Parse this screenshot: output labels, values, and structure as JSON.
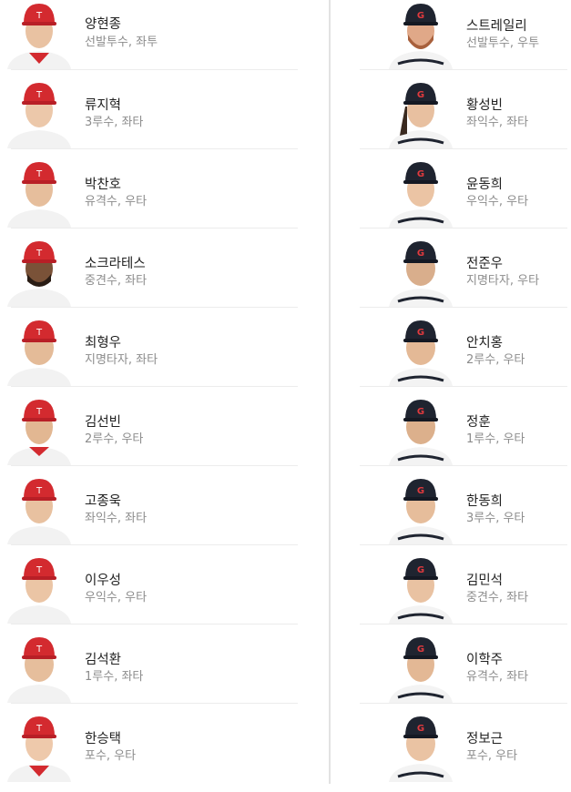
{
  "colors": {
    "home_cap": "#d32a2f",
    "away_cap": "#1f2430",
    "home_jersey": "#f2f2f2",
    "away_jersey": "#f3f3f3"
  },
  "home_players": [
    {
      "name": "양현종",
      "info": "선발투수, 좌투"
    },
    {
      "name": "류지혁",
      "info": "3루수, 좌타"
    },
    {
      "name": "박찬호",
      "info": "유격수, 우타"
    },
    {
      "name": "소크라테스",
      "info": "중견수, 좌타"
    },
    {
      "name": "최형우",
      "info": "지명타자, 좌타"
    },
    {
      "name": "김선빈",
      "info": "2루수, 우타"
    },
    {
      "name": "고종욱",
      "info": "좌익수, 좌타"
    },
    {
      "name": "이우성",
      "info": "우익수, 우타"
    },
    {
      "name": "김석환",
      "info": "1루수, 좌타"
    },
    {
      "name": "한승택",
      "info": "포수, 우타"
    }
  ],
  "away_players": [
    {
      "name": "스트레일리",
      "info": "선발투수, 우투"
    },
    {
      "name": "황성빈",
      "info": "좌익수, 좌타"
    },
    {
      "name": "윤동희",
      "info": "우익수, 우타"
    },
    {
      "name": "전준우",
      "info": "지명타자, 우타"
    },
    {
      "name": "안치홍",
      "info": "2루수, 우타"
    },
    {
      "name": "정훈",
      "info": "1루수, 우타"
    },
    {
      "name": "한동희",
      "info": "3루수, 우타"
    },
    {
      "name": "김민석",
      "info": "중견수, 좌타"
    },
    {
      "name": "이학주",
      "info": "유격수, 좌타"
    },
    {
      "name": "정보근",
      "info": "포수, 우타"
    }
  ]
}
